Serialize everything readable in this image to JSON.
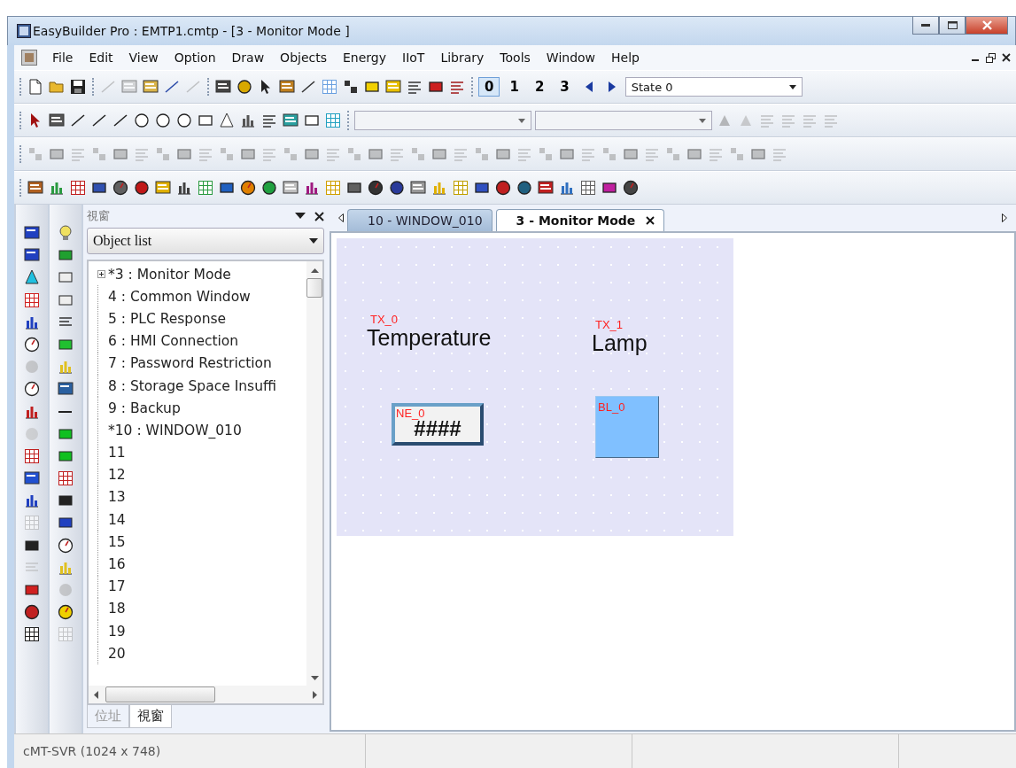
{
  "window": {
    "title": "EasyBuilder Pro : EMTP1.cmtp - [3 - Monitor Mode ]"
  },
  "menu": [
    "File",
    "Edit",
    "View",
    "Option",
    "Draw",
    "Objects",
    "Energy",
    "IIoT",
    "Library",
    "Tools",
    "Window",
    "Help"
  ],
  "state_toolbar": {
    "states": [
      {
        "label": "0",
        "selected": true
      },
      {
        "label": "1",
        "selected": false
      },
      {
        "label": "2",
        "selected": false
      },
      {
        "label": "3",
        "selected": false
      }
    ],
    "state_select": "State 0"
  },
  "panel": {
    "title": "視窗",
    "view_select": "Object list",
    "tree": [
      {
        "label": "*3 : Monitor Mode",
        "expanded": false
      },
      {
        "label": "4 : Common Window"
      },
      {
        "label": "5 : PLC Response"
      },
      {
        "label": "6 : HMI Connection"
      },
      {
        "label": "7 : Password Restriction"
      },
      {
        "label": "8 : Storage Space Insuffi"
      },
      {
        "label": "9 : Backup"
      },
      {
        "label": "*10 : WINDOW_010"
      },
      {
        "label": "11"
      },
      {
        "label": "12"
      },
      {
        "label": "13"
      },
      {
        "label": "14"
      },
      {
        "label": "15"
      },
      {
        "label": "16"
      },
      {
        "label": "17"
      },
      {
        "label": "18"
      },
      {
        "label": "19"
      },
      {
        "label": "20"
      }
    ],
    "tabs": [
      {
        "label": "位址",
        "selected": false
      },
      {
        "label": "視窗",
        "selected": true
      }
    ]
  },
  "editor": {
    "tabs": [
      {
        "label": "10 - WINDOW_010",
        "selected": false
      },
      {
        "label": "3 - Monitor Mode",
        "selected": true
      }
    ],
    "objects": [
      {
        "kind": "text",
        "text": "Temperature",
        "tag": "TX_0"
      },
      {
        "kind": "text",
        "text": "Lamp",
        "tag": "TX_1"
      },
      {
        "kind": "numeric",
        "text": "####",
        "tag": "NE_0"
      },
      {
        "kind": "lamp",
        "tag": "BL_0"
      }
    ]
  },
  "status_bar": [
    "cMT-SVR (1024 x 748)"
  ]
}
